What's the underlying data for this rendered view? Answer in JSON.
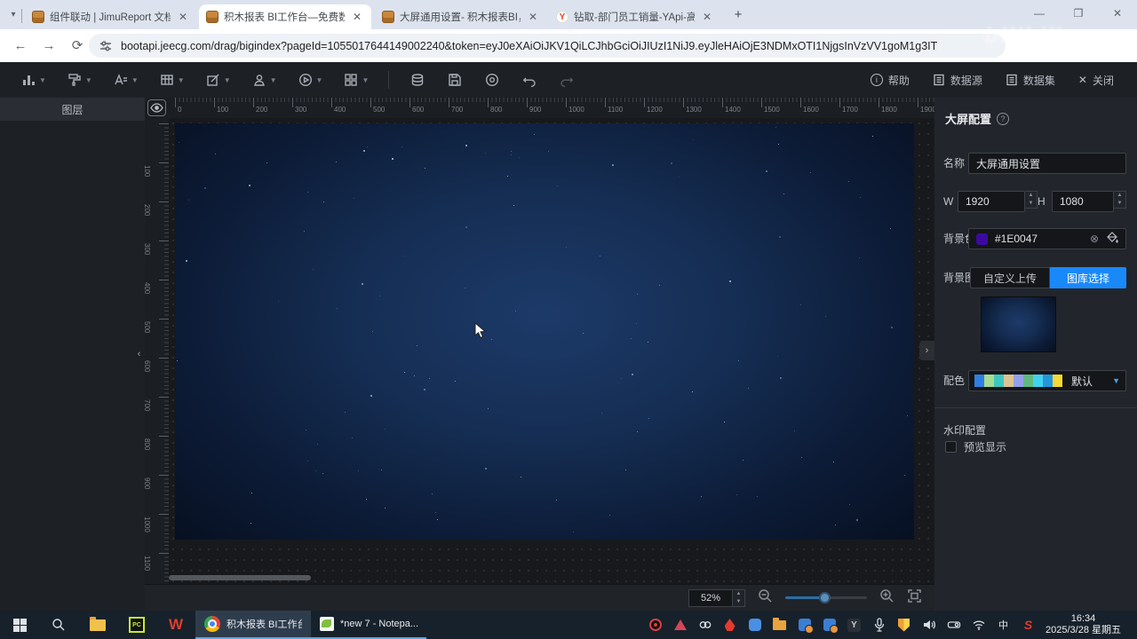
{
  "browser": {
    "tabs": [
      {
        "title": "组件联动 | JimuReport 文档"
      },
      {
        "title": "积木报表 BI工作台—免费数据"
      },
      {
        "title": "大屏通用设置- 积木报表BI，免"
      },
      {
        "title": "钻取-部门员工销量-YApi-高效"
      }
    ],
    "url": "bootapi.jeecg.com/drag/bigindex?pageId=1055017644149002240&token=eyJ0eXAiOiJKV1QiLCJhbGciOiJIUzI1NiJ9.eyJleHAiOjE3NDMxOTI1NjgsInVzVV1goM1g3IT",
    "watermark": "bilibili",
    "yapi_favicon_letter": "Y"
  },
  "toolbar": {
    "left_icons": [
      "bar-chart",
      "paint-brush",
      "text",
      "table",
      "edit",
      "user",
      "play",
      "apps-grid"
    ],
    "help": "帮助",
    "datasource": "数据源",
    "dataset": "数据集",
    "close": "关闭"
  },
  "layers_panel": {
    "title": "图层"
  },
  "ruler": {
    "h_labels": [
      "0",
      "100",
      "200",
      "300",
      "400",
      "500",
      "600",
      "700",
      "800",
      "900",
      "1000",
      "1100",
      "1200",
      "1300",
      "1400",
      "1500",
      "1600",
      "1700",
      "1800",
      "1900"
    ],
    "v_labels": [
      "100",
      "200",
      "300",
      "400",
      "500",
      "600",
      "700",
      "800",
      "900",
      "1000",
      "1100"
    ]
  },
  "zoombar": {
    "zoom_value": "52%"
  },
  "config_panel": {
    "title": "大屏配置",
    "name_label": "名称",
    "name_value": "大屏通用设置",
    "w_label": "W",
    "w_value": "1920",
    "h_label": "H",
    "h_value": "1080",
    "bg_color_label": "背景色",
    "bg_color_value": "#1E0047",
    "bg_color_swatch": "#3c0aa0",
    "bg_image_label": "背景图",
    "upload_button": "自定义上传",
    "gallery_button": "图库选择",
    "palette_label": "配色",
    "palette_value": "默认",
    "palette_colors": [
      "#2f7ee3",
      "#a5dc92",
      "#3cc8c0",
      "#dcc392",
      "#92a0e8",
      "#5fb97e",
      "#41d2f2",
      "#2596dc",
      "#f7d834"
    ],
    "watermark_section_title": "水印配置",
    "preview_checkbox_label": "预览显示"
  },
  "taskbar": {
    "chrome_task": "积木报表 BI工作台...",
    "notepad_task": "*new 7 - Notepa...",
    "pycharm_label": "PC",
    "wps_label": "W",
    "ime_label": "中",
    "sogou_label": "S",
    "yapi_tray_label": "Y",
    "time": "16:34",
    "date": "2025/3/28 星期五"
  }
}
